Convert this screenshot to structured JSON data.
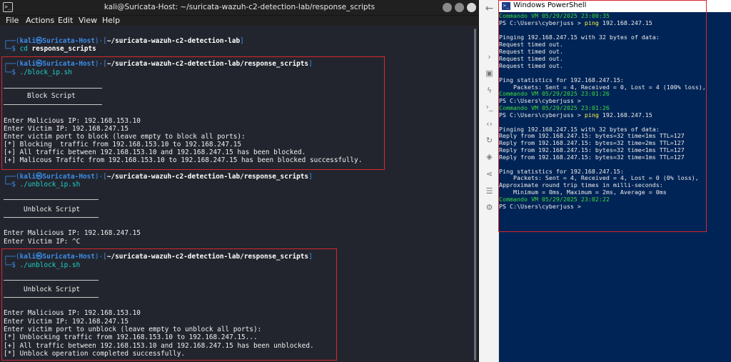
{
  "kali": {
    "title": "kali@Suricata-Host: ~/suricata-wazuh-c2-detection-lab/response_scripts",
    "menu": [
      "File",
      "Actions",
      "Edit",
      "View",
      "Help"
    ],
    "prompt": {
      "open": "┌──(",
      "user": "kali㉿Suricata-Host",
      "mid": ")-[",
      "path_lab": "~/suricata-wazuh-c2-detection-lab",
      "path_scripts": "~/suricata-wazuh-c2-detection-lab/response_scripts",
      "close": "]",
      "cmd_prefix": "└─$ "
    },
    "cmd1": {
      "cmd": "cd",
      "arg": " response_scripts"
    },
    "block": {
      "cmd": "./block_ip.sh",
      "banner": "Block Script",
      "lines": [
        "Enter Malicious IP: 192.168.153.10",
        "Enter Victim IP: 192.168.247.15",
        "Enter victim port to block (leave empty to block all ports):",
        "[*] Blocking  traffic from 192.168.153.10 to 192.168.247.15",
        "[+] All traffic between 192.168.153.10 and 192.168.247.15 has been blocked.",
        "[+] Malicous Trafifc from 192.168.153.10 to 192.168.247.15 has been blocked successfully."
      ]
    },
    "unblock1": {
      "cmd": "./unblock_ip.sh",
      "banner": "Unblock Script",
      "lines": [
        "Enter Malicious IP: 192.168.247.15",
        "Enter Victim IP: ^C"
      ]
    },
    "unblock2": {
      "cmd": "./unblock_ip.sh",
      "banner": "Unblock Script",
      "lines": [
        "Enter Malicious IP: 192.168.153.10",
        "Enter Victim IP: 192.168.247.15",
        "Enter victim port to unblock (leave empty to unblock all ports):",
        "[*] Unblocking traffic from 192.168.153.10 to 192.168.247.15...",
        "[+] All traffic between 192.168.153.10 and 192.168.247.15 has been unblocked.",
        "[*] Unblock operation completed successfully."
      ]
    }
  },
  "powershell": {
    "title": "Windows PowerShell",
    "ts1": "Commando VM 05/29/2025 23:00:35",
    "ps_prompt": "PS C:\\Users\\cyberjuss > ",
    "ping_cmd": "ping",
    "ping_arg": " 192.168.247.15",
    "ping_header": "Pinging 192.168.247.15 with 32 bytes of data:",
    "timeout": "Request timed out.",
    "stats_header": "Ping statistics for 192.168.247.15:",
    "stats_lost": "    Packets: Sent = 4, Received = 0, Lost = 4 (100% loss),",
    "ts2": "Commando VM 05/29/2025 23:01:26",
    "ps_prompt_bare": "PS C:\\Users\\cyberjuss >",
    "ts3": "Commando VM 05/29/2025 23:01:26",
    "replies": [
      "Reply from 192.168.247.15: bytes=32 time<1ms TTL=127",
      "Reply from 192.168.247.15: bytes=32 time=2ms TTL=127",
      "Reply from 192.168.247.15: bytes=32 time<1ms TTL=127",
      "Reply from 192.168.247.15: bytes=32 time=1ms TTL=127"
    ],
    "stats_ok": "    Packets: Sent = 4, Received = 4, Lost = 0 (0% loss),",
    "rtt_header": "Approximate round trip times in milli-seconds:",
    "rtt_values": "    Minimum = 0ms, Maximum = 2ms, Average = 0ms",
    "ts4": "Commando VM 05/29/2025 23:02:22"
  },
  "colors": {
    "highlight_box": "#d9262f",
    "kali_bg": "#23252e",
    "ps_bg": "#012456"
  }
}
